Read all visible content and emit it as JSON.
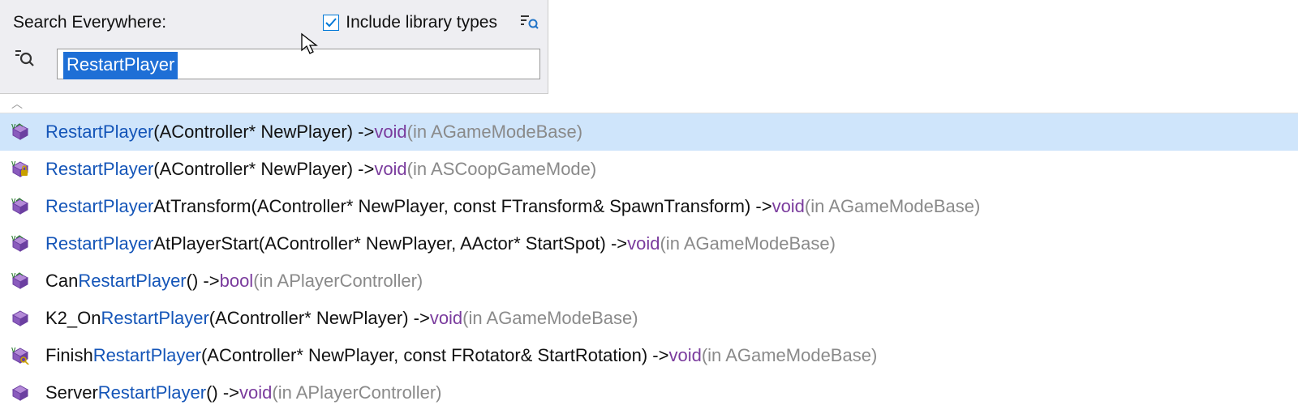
{
  "header": {
    "label": "Search Everywhere:",
    "checkbox_label": "Include library types",
    "checkbox_checked": true,
    "search_value": "RestartPlayer"
  },
  "results": [
    {
      "icon": "method-virtual",
      "selected": true,
      "prefix": "",
      "match": "RestartPlayer",
      "params": "(AController* NewPlayer) -> ",
      "ret": "void",
      "context": " (in AGameModeBase)"
    },
    {
      "icon": "method-protected",
      "selected": false,
      "prefix": "",
      "match": "RestartPlayer",
      "params": "(AController* NewPlayer) -> ",
      "ret": "void",
      "context": " (in ASCoopGameMode)"
    },
    {
      "icon": "method-virtual",
      "selected": false,
      "prefix": "",
      "match": "RestartPlayer",
      "suffix": "AtTransform",
      "params": "(AController* NewPlayer, const FTransform& SpawnTransform) -> ",
      "ret": "void",
      "context": " (in AGameModeBase)"
    },
    {
      "icon": "method-virtual",
      "selected": false,
      "prefix": "",
      "match": "RestartPlayer",
      "suffix": "AtPlayerStart",
      "params": "(AController* NewPlayer, AActor* StartSpot) -> ",
      "ret": "void",
      "context": " (in AGameModeBase)"
    },
    {
      "icon": "method-virtual",
      "selected": false,
      "prefix": "Can",
      "match": "RestartPlayer",
      "params": "() -> ",
      "ret": "bool",
      "context": " (in APlayerController)"
    },
    {
      "icon": "method",
      "selected": false,
      "prefix": "K2_On",
      "match": "RestartPlayer",
      "params": "(AController* NewPlayer) -> ",
      "ret": "void",
      "context": " (in AGameModeBase)"
    },
    {
      "icon": "method-key",
      "selected": false,
      "prefix": "Finish",
      "match": "RestartPlayer",
      "params": "(AController* NewPlayer, const FRotator& StartRotation) -> ",
      "ret": "void",
      "context": " (in AGameModeBase)"
    },
    {
      "icon": "method",
      "selected": false,
      "prefix": "Server",
      "match": "RestartPlayer",
      "params": "() -> ",
      "ret": "void",
      "context": " (in APlayerController)"
    }
  ]
}
